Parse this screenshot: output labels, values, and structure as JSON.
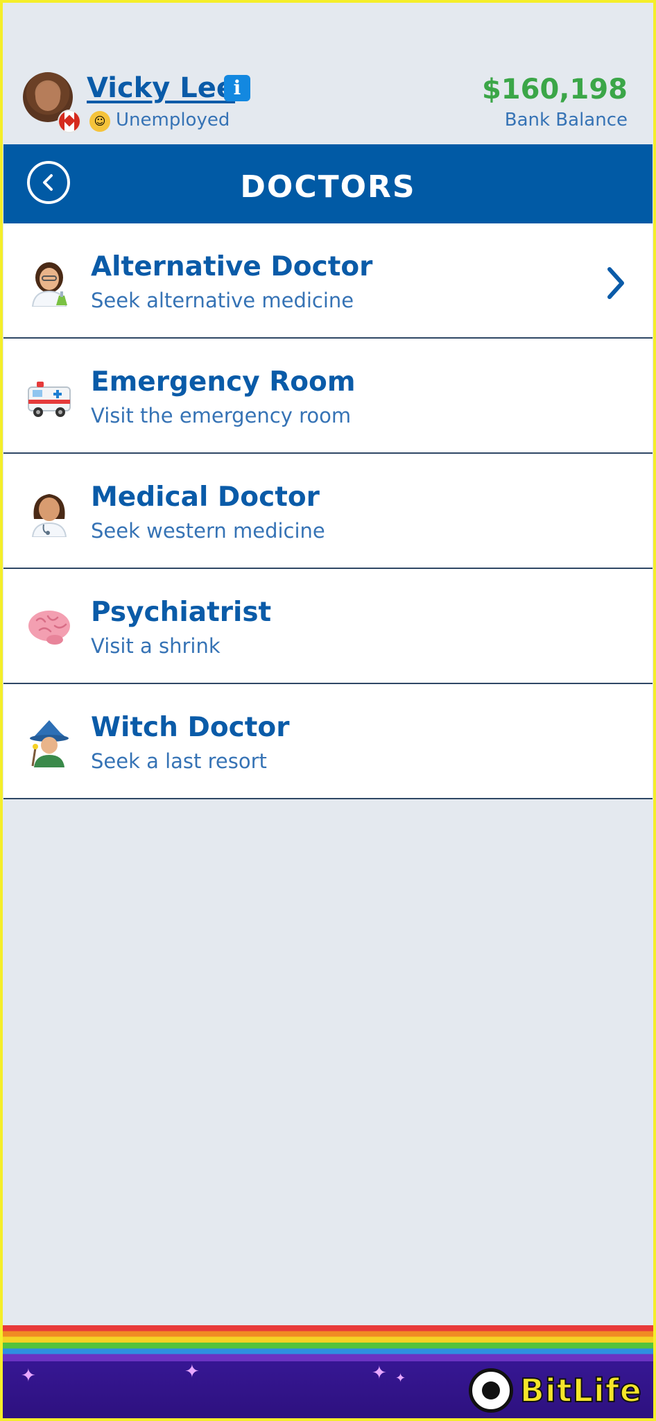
{
  "header": {
    "name": "Vicky Lee",
    "status": "Unemployed",
    "balance": "$160,198",
    "balance_label": "Bank Balance"
  },
  "titlebar": {
    "title": "DOCTORS"
  },
  "items": [
    {
      "title": "Alternative Doctor",
      "subtitle": "Seek alternative medicine",
      "icon": "doctor-scientist-icon"
    },
    {
      "title": "Emergency Room",
      "subtitle": "Visit the emergency room",
      "icon": "ambulance-icon"
    },
    {
      "title": "Medical Doctor",
      "subtitle": "Seek western medicine",
      "icon": "health-worker-icon"
    },
    {
      "title": "Psychiatrist",
      "subtitle": "Visit a shrink",
      "icon": "brain-icon"
    },
    {
      "title": "Witch Doctor",
      "subtitle": "Seek a last resort",
      "icon": "wizard-icon"
    }
  ],
  "footer": {
    "logo_text": "BitLife"
  },
  "colors": {
    "brand_blue": "#015aa5",
    "text_blue": "#0a5ba8",
    "money_green": "#3ba648",
    "background": "#e4e9ef"
  }
}
